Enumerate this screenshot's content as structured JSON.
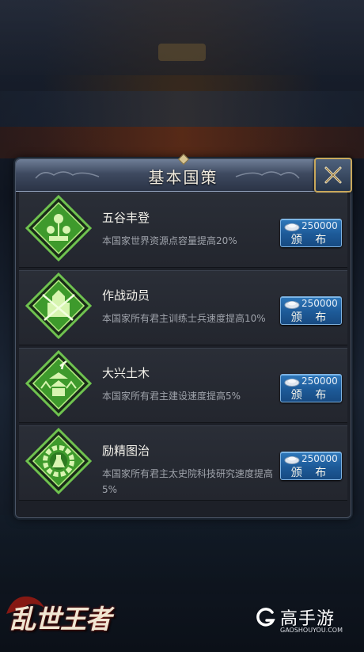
{
  "dialog": {
    "title": "基本国策"
  },
  "policies": [
    {
      "name": "五谷丰登",
      "desc": "本国家世界资源点容量提高20%",
      "cost": "250000",
      "button": "颁 布",
      "icon": "grain-harvest-icon"
    },
    {
      "name": "作战动员",
      "desc": "本国家所有君主训练士兵速度提高10%",
      "cost": "250000",
      "button": "颁 布",
      "icon": "castle-swords-icon"
    },
    {
      "name": "大兴土木",
      "desc": "本国家所有君主建设速度提高5%",
      "cost": "250000",
      "button": "颁 布",
      "icon": "pagoda-hammer-icon"
    },
    {
      "name": "励精图治",
      "desc": "本国家所有君主太史院科技研究速度提高5%",
      "cost": "250000",
      "button": "颁 布",
      "icon": "gear-flask-icon"
    }
  ],
  "branding": {
    "game_logo": "乱世王者",
    "site_name": "高手游",
    "site_url": "GAOSHOUYOU.COM"
  },
  "colors": {
    "emblem_green": "#3fa32e",
    "button_blue": "#1d5a98",
    "close_gold": "#c9a85b"
  }
}
